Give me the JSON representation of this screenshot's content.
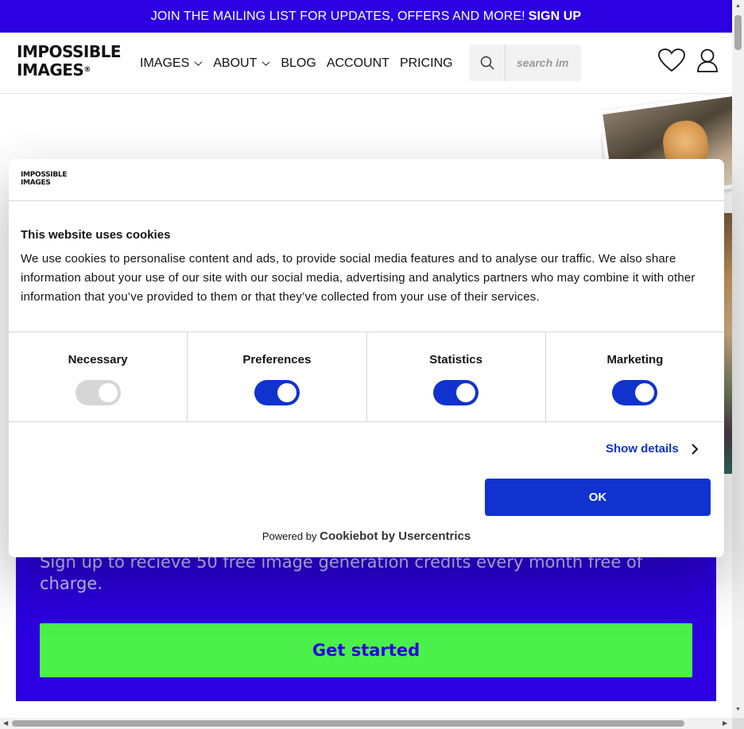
{
  "banner": {
    "text": "JOIN THE MAILING LIST FOR UPDATES, OFFERS AND MORE!",
    "link": "SIGN UP"
  },
  "header": {
    "logo_line1": "IMPOSSIBLE",
    "logo_line2": "IMAGES",
    "logo_reg": "®",
    "nav": [
      {
        "label": "IMAGES",
        "has_dropdown": true
      },
      {
        "label": "ABOUT",
        "has_dropdown": true
      },
      {
        "label": "BLOG",
        "has_dropdown": false
      },
      {
        "label": "ACCOUNT",
        "has_dropdown": false
      },
      {
        "label": "PRICING",
        "has_dropdown": false
      }
    ],
    "search_placeholder": "search im",
    "icons": [
      "search-icon",
      "heart-icon",
      "user-icon"
    ]
  },
  "promo": {
    "text": "Sign up to recieve 50 free image generation credits every month free of charge.",
    "cta": "Get started"
  },
  "cookie": {
    "logo_line1": "IMPOSSIBLE",
    "logo_line2": "IMAGES",
    "title": "This website uses cookies",
    "body": "We use cookies to personalise content and ads, to provide social media features and to analyse our traffic. We also share information about your use of our site with our social media, advertising and analytics partners who may combine it with other information that you’ve provided to them or that they’ve collected from your use of their services.",
    "toggles": [
      {
        "label": "Necessary",
        "on": true,
        "disabled": true
      },
      {
        "label": "Preferences",
        "on": true,
        "disabled": false
      },
      {
        "label": "Statistics",
        "on": true,
        "disabled": false
      },
      {
        "label": "Marketing",
        "on": true,
        "disabled": false
      }
    ],
    "show_details": "Show details",
    "ok": "OK",
    "powered_by": "Powered by",
    "powered_brand": "Cookiebot by Usercentrics"
  },
  "colors": {
    "brand_blue": "#2c00e0",
    "cookie_blue": "#1032cf",
    "cta_green": "#4cf04a"
  }
}
